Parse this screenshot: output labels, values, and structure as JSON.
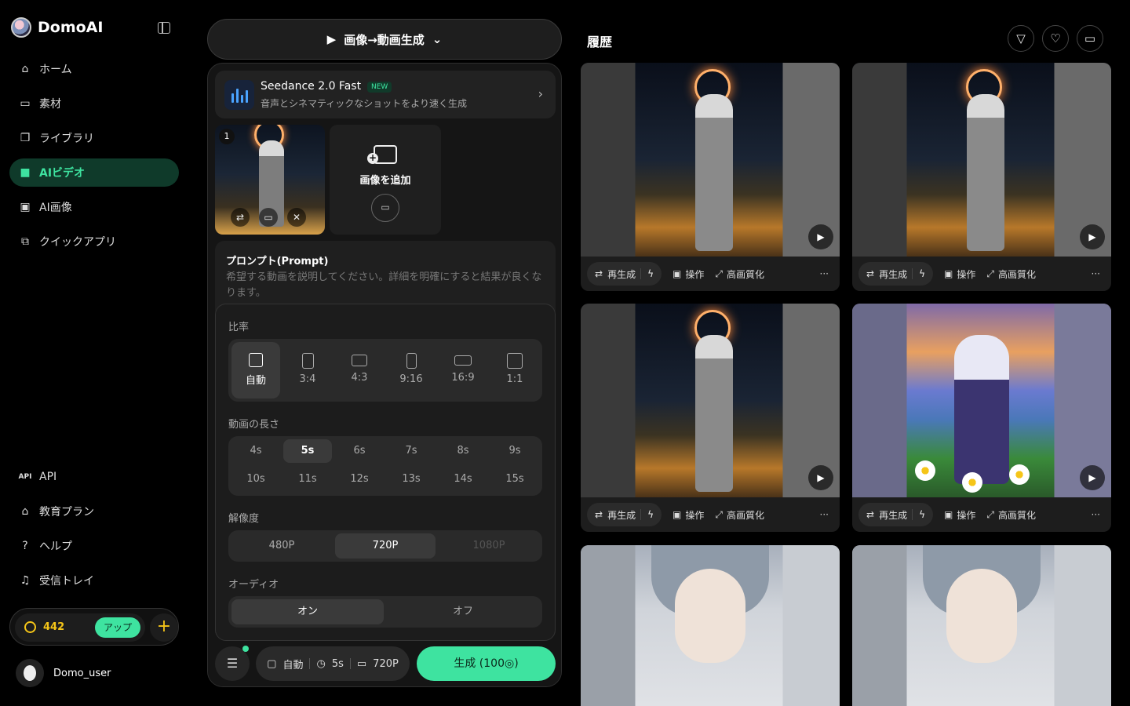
{
  "brand": {
    "name": "DomoAI"
  },
  "nav": {
    "items": [
      {
        "label": "ホーム",
        "icon": "home-icon"
      },
      {
        "label": "素材",
        "icon": "materials-icon"
      },
      {
        "label": "ライブラリ",
        "icon": "library-icon"
      },
      {
        "label": "AIビデオ",
        "icon": "video-icon",
        "active": true
      },
      {
        "label": "AI画像",
        "icon": "image-icon"
      },
      {
        "label": "クイックアプリ",
        "icon": "quick-app-icon"
      }
    ],
    "bottom_items": [
      {
        "label": "API",
        "icon": "api-icon",
        "icon_text": "API"
      },
      {
        "label": "教育プラン",
        "icon": "education-icon"
      },
      {
        "label": "ヘルプ",
        "icon": "help-icon"
      },
      {
        "label": "受信トレイ",
        "icon": "bell-icon"
      }
    ]
  },
  "credits": {
    "amount": "442",
    "upgrade_label": "アップ",
    "add_label": "+"
  },
  "user": {
    "name": "Domo_user"
  },
  "mode": {
    "label": "画像→動画生成"
  },
  "model": {
    "name": "Seedance 2.0 Fast",
    "badge": "NEW",
    "description": "音声とシネマティックなショットをより速く生成"
  },
  "images": {
    "index": "1",
    "add_label": "画像を追加"
  },
  "prompt": {
    "title": "プロンプト(Prompt)",
    "placeholder": "希望する動画を説明してください。詳細を明確にすると結果が良くなります。"
  },
  "settings": {
    "ratio_label": "比率",
    "ratios": [
      "自動",
      "3:4",
      "4:3",
      "9:16",
      "16:9",
      "1:1"
    ],
    "ratio_selected": "自動",
    "length_label": "動画の長さ",
    "lengths": [
      "4s",
      "5s",
      "6s",
      "7s",
      "8s",
      "9s",
      "10s",
      "11s",
      "12s",
      "13s",
      "14s",
      "15s"
    ],
    "length_selected": "5s",
    "resolution_label": "解像度",
    "resolutions": [
      "480P",
      "720P",
      "1080P"
    ],
    "resolution_selected": "720P",
    "resolution_disabled": "1080P",
    "audio_label": "オーディオ",
    "audio_on": "オン",
    "audio_off": "オフ"
  },
  "summary": {
    "ratio": "自動",
    "length": "5s",
    "resolution": "720P"
  },
  "generate": {
    "label": "生成 (100◎)"
  },
  "history": {
    "title": "履歴",
    "card_actions": {
      "regenerate": "再生成",
      "operate": "操作",
      "upscale": "高画質化",
      "more": "···"
    }
  },
  "colors": {
    "accent": "#3ee3a0",
    "coin": "#f5c518",
    "active_bg": "#0f3a2a"
  }
}
